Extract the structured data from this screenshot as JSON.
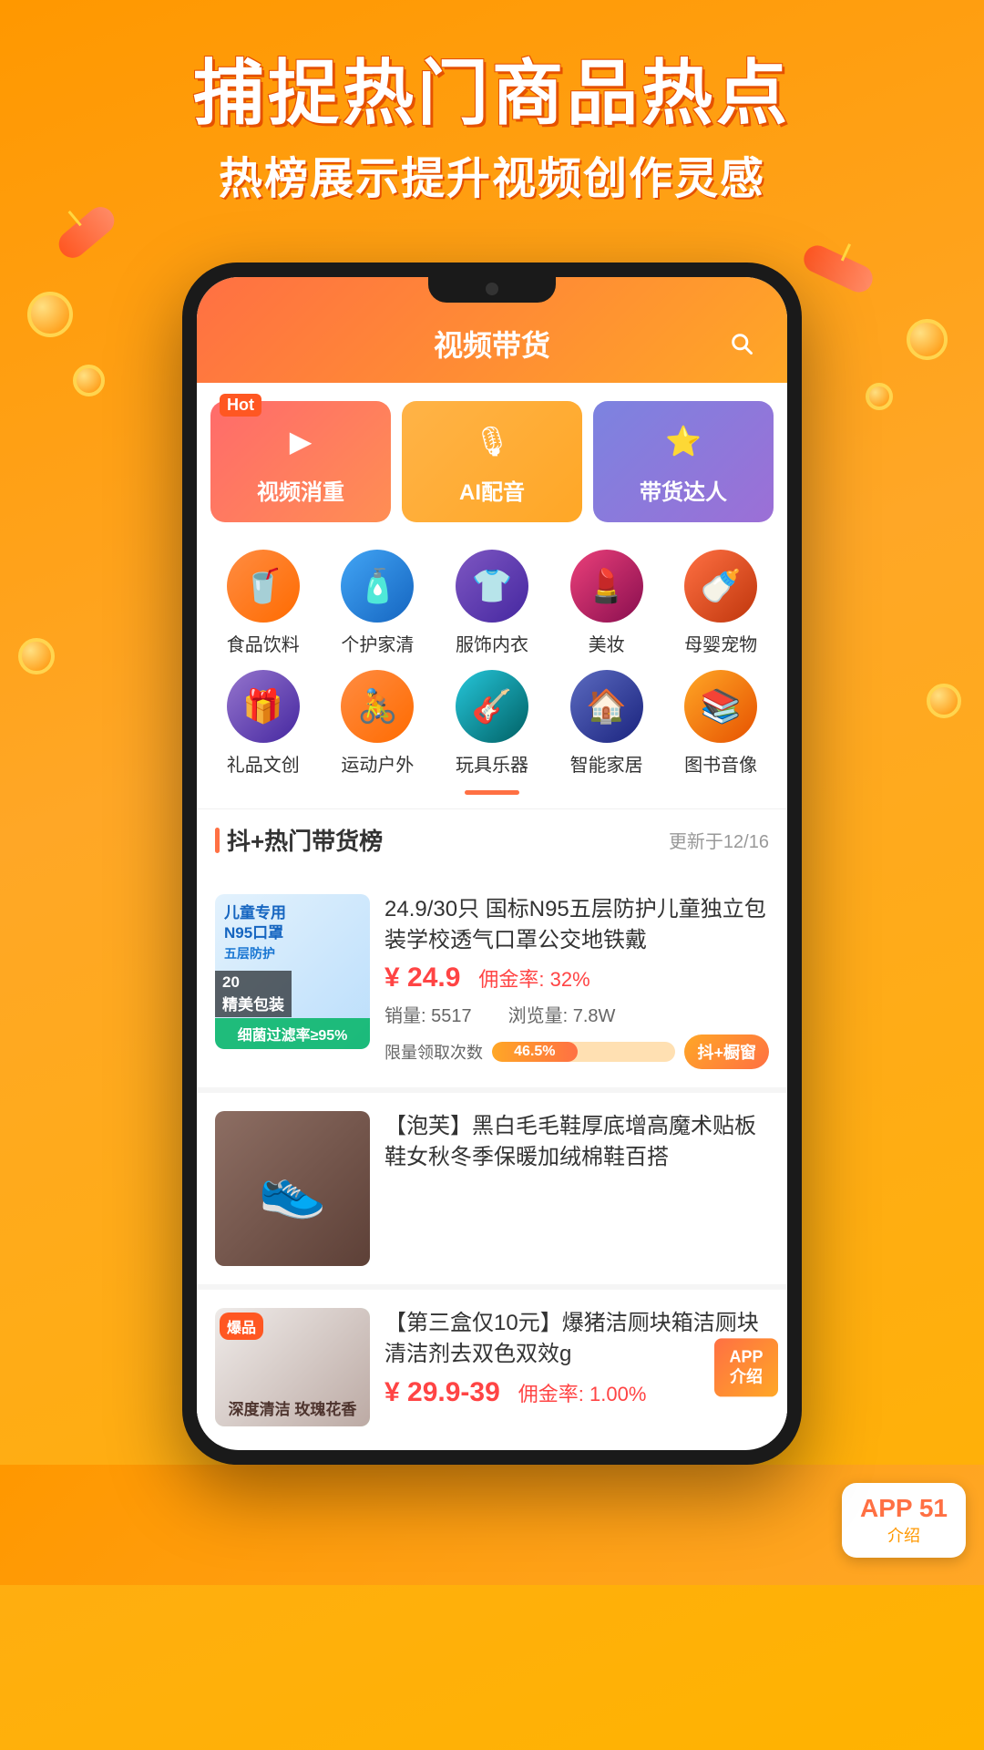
{
  "header": {
    "main_title": "捕捉热门商品热点",
    "sub_title": "热榜展示提升视频创作灵感"
  },
  "app": {
    "title": "视频带货",
    "feature_cards": [
      {
        "label": "视频消重",
        "icon": "▶",
        "badge": "Hot"
      },
      {
        "label": "AI配音",
        "icon": "🎙"
      },
      {
        "label": "带货达人",
        "icon": "⭐"
      }
    ],
    "categories_row1": [
      {
        "label": "食品饮料",
        "icon": "🥤"
      },
      {
        "label": "个护家清",
        "icon": "🧴"
      },
      {
        "label": "服饰内衣",
        "icon": "👕"
      },
      {
        "label": "美妆",
        "icon": "💄"
      },
      {
        "label": "母婴宠物",
        "icon": "🍼"
      }
    ],
    "categories_row2": [
      {
        "label": "礼品文创",
        "icon": "🎁"
      },
      {
        "label": "运动户外",
        "icon": "🚴"
      },
      {
        "label": "玩具乐器",
        "icon": "🎸"
      },
      {
        "label": "智能家居",
        "icon": "🏠"
      },
      {
        "label": "图书音像",
        "icon": "📚"
      }
    ],
    "hot_list": {
      "title": "抖+热门带货榜",
      "update_time": "更新于12/16"
    },
    "products": [
      {
        "title": "24.9/30只 国标N95五层防护儿童独立包装学校透气口罩公交地铁戴",
        "price": "¥ 24.9",
        "commission_rate": "佣金率: 32%",
        "sales": "销量: 5517",
        "views": "浏览量: 7.8W",
        "progress_label": "限量领取次数",
        "progress_pct": 46.5,
        "progress_text": "46.5%",
        "platform": "抖+橱窗",
        "img_title": "儿童专用\nN95口罩",
        "img_badge": "20\n精美包装",
        "img_bottom": "细菌过滤率≥95%"
      },
      {
        "title": "【泡芙】黑白毛毛鞋厚底增高魔术贴板鞋女秋冬季保暖加绒棉鞋百搭",
        "price": "",
        "commission_rate": "",
        "sales": "",
        "views": ""
      },
      {
        "title": "【第三盒仅10元】爆猪洁厕块箱洁厕块清洁剂去双色双效g",
        "price": "¥ 29.9-39",
        "commission_rate": "佣金率: 1.00%",
        "explosion_badge": "爆品",
        "app_intro": "APP\n介绍"
      }
    ]
  },
  "bottom": {
    "app51_text": "APP 51",
    "app51_sub": "介绍"
  }
}
